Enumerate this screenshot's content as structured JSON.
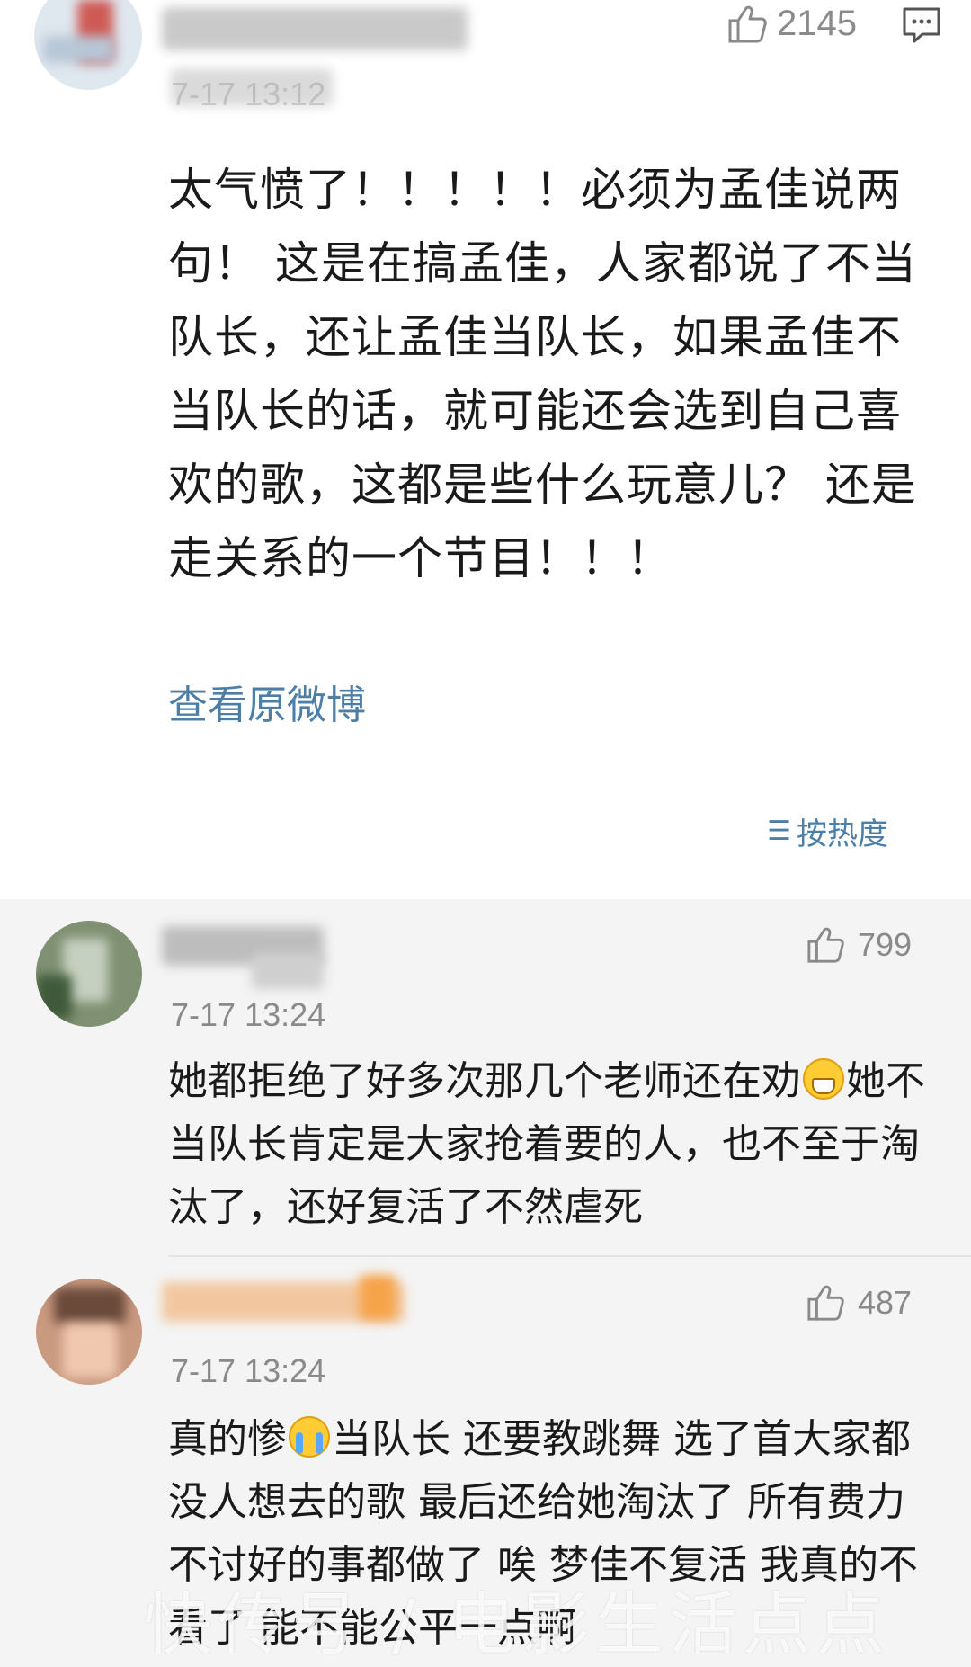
{
  "main_comment": {
    "like_count": "2145",
    "time": "7-17 13:12",
    "text": "太气愤了！！！！！必须为孟佳说两句！ 这是在搞孟佳，人家都说了不当队长，还让孟佳当队长，如果孟佳不当队长的话，就可能还会选到自己喜欢的歌，这都是些什么玩意儿？ 还是走关系的一个节目！！！",
    "view_original_label": "查看原微博"
  },
  "sort": {
    "label": "按热度",
    "icon": "sort-icon"
  },
  "replies": [
    {
      "time": "7-17 13:24",
      "like_count": "799",
      "text_before_emoji": "她都拒绝了好多次那几个老师还在劝",
      "emoji": "grin-emoji",
      "text_after_emoji": "她不当队长肯定是大家抢着要的人，也不至于淘汰了，还好复活了不然虐死"
    },
    {
      "time": "7-17 13:24",
      "like_count": "487",
      "text_before_emoji": "真的惨",
      "emoji": "crying-emoji",
      "text_after_emoji": "当队长 还要教跳舞 选了首大家都没人想去的歌 最后还给她淘汰了 所有费力不讨好的事都做了 唉 梦佳不复活 我真的不看了 能不能公平一点啊"
    }
  ],
  "watermark": "快传号 / 电影生活点点",
  "icons": {
    "like": "thumbs-up-icon",
    "reply": "comment-icon"
  },
  "colors": {
    "link_blue": "#4d7fa6",
    "meta_gray": "#8a8a8a",
    "reply_bg": "#f4f4f4"
  }
}
